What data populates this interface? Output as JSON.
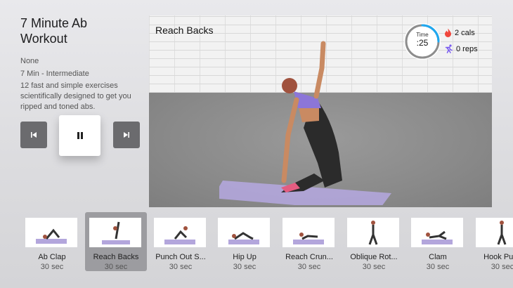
{
  "workout": {
    "title_line1": "7 Minute Ab",
    "title_line2": "Workout",
    "equipment": "None",
    "level": "7 Min - Intermediate",
    "description": "12 fast and simple exercises scientifically designed to get you ripped and toned abs."
  },
  "controls": {
    "prev_icon": "skip-back-icon",
    "pause_icon": "pause-icon",
    "next_icon": "skip-forward-icon"
  },
  "player": {
    "exercise_title": "Reach Backs",
    "timer_label": "Time",
    "timer_value": ":25",
    "timer_progress": 0.25,
    "calories": "2 cals",
    "reps": "0 reps",
    "colors": {
      "accent": "#1fa8f0",
      "flame": "#f0463c",
      "runner": "#7a5cf0"
    }
  },
  "exercises": [
    {
      "name": "Ab Clap",
      "duration": "30 sec"
    },
    {
      "name": "Reach Backs",
      "duration": "30 sec",
      "selected": true
    },
    {
      "name": "Punch Out S...",
      "duration": "30 sec"
    },
    {
      "name": "Hip Up",
      "duration": "30 sec"
    },
    {
      "name": "Reach Crun...",
      "duration": "30 sec"
    },
    {
      "name": "Oblique Rot...",
      "duration": "30 sec"
    },
    {
      "name": "Clam",
      "duration": "30 sec"
    },
    {
      "name": "Hook Punc",
      "duration": "30 sec"
    }
  ]
}
